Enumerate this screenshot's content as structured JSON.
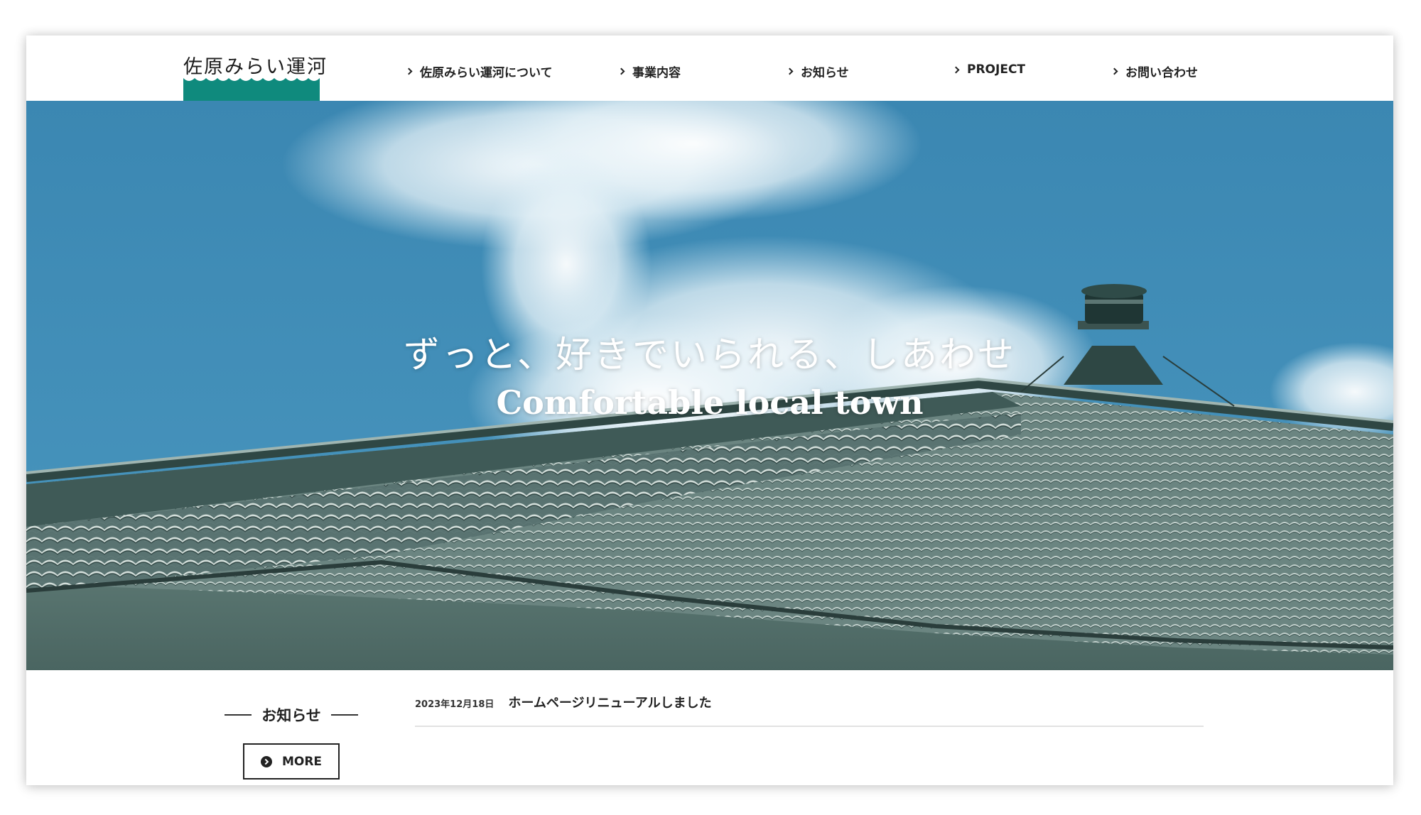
{
  "header": {
    "logo_text": "佐原みらい運河",
    "nav": [
      {
        "label": "佐原みらい運河について"
      },
      {
        "label": "事業内容"
      },
      {
        "label": "お知らせ"
      },
      {
        "label": "PROJECT"
      },
      {
        "label": "お問い合わせ"
      }
    ]
  },
  "hero": {
    "tagline_jp": "ずっと、好きでいられる、しあわせ",
    "tagline_en": "Comfortable local town"
  },
  "news": {
    "heading": "お知らせ",
    "more_label": "MORE",
    "items": [
      {
        "date": "2023年12月18日",
        "title": "ホームページリニューアルしました"
      }
    ]
  },
  "colors": {
    "brand": "#0f8a7d",
    "sky": "#3f8db5",
    "roof": "#5f7a76"
  }
}
